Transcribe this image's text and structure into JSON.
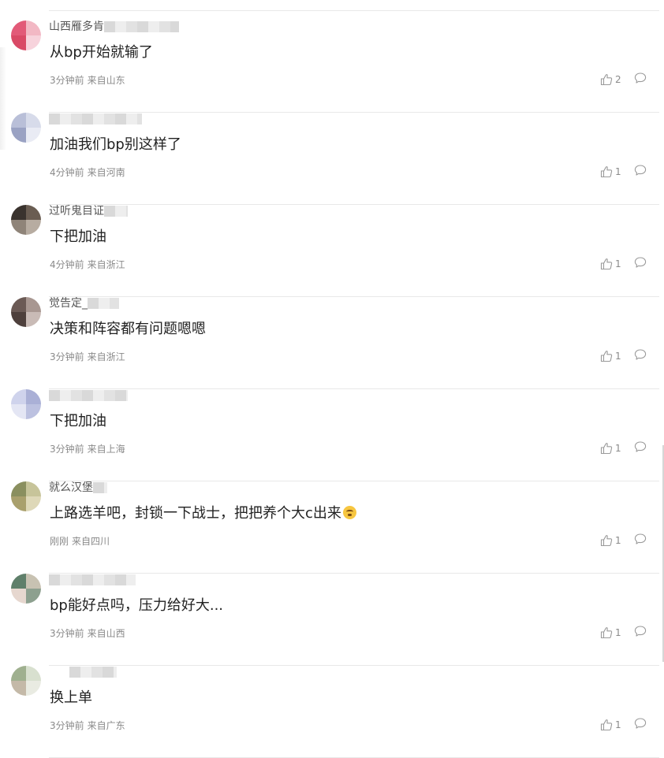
{
  "comments": [
    {
      "username": "山西雁多肯",
      "text": "从bp开始就输了",
      "time": "3分钟前",
      "location": "来自山东",
      "likes": "2",
      "avatar_colors": [
        "#e25a78",
        "#f2b8c4",
        "#d94a66",
        "#f7d3dc"
      ]
    },
    {
      "username": "",
      "text": "加油我们bp别这样了",
      "time": "4分钟前",
      "location": "来自河南",
      "likes": "1",
      "avatar_colors": [
        "#b9bfd8",
        "#d7dbea",
        "#9aa2c3",
        "#e9ebf4"
      ]
    },
    {
      "username": "过听鬼目证",
      "text": "下把加油",
      "time": "4分钟前",
      "location": "来自浙江",
      "likes": "1",
      "avatar_colors": [
        "#3a332e",
        "#6a5d52",
        "#8f8479",
        "#b7aca1"
      ]
    },
    {
      "username": "觉告定_",
      "text": "决策和阵容都有问题嗯嗯",
      "time": "3分钟前",
      "location": "来自浙江",
      "likes": "1",
      "avatar_colors": [
        "#6b5a55",
        "#a89791",
        "#4e403c",
        "#c9bbb6"
      ]
    },
    {
      "username": "",
      "text": "下把加油",
      "time": "3分钟前",
      "location": "来自上海",
      "likes": "1",
      "avatar_colors": [
        "#cfd3ec",
        "#aab0d6",
        "#e4e6f4",
        "#bcc1e0"
      ]
    },
    {
      "username": "就么汉堡",
      "text": "上路选羊吧，封锁一下战士，把把养个大c出来",
      "time": "刚刚",
      "location": "来自四川",
      "likes": "1",
      "avatar_colors": [
        "#8a8f5f",
        "#c7c49a",
        "#a9a06d",
        "#ded8b8"
      ]
    },
    {
      "username": "",
      "text": "bp能好点吗，压力给好大...",
      "time": "3分钟前",
      "location": "来自山西",
      "likes": "1",
      "avatar_colors": [
        "#5f7f6a",
        "#c8c2b2",
        "#e6d7cf",
        "#8da08f"
      ]
    },
    {
      "username": "",
      "text": "换上单",
      "time": "3分钟前",
      "location": "来自广东",
      "likes": "1",
      "avatar_colors": [
        "#9fb08f",
        "#d8e0cf",
        "#c4b9a8",
        "#e9ebe2"
      ]
    }
  ],
  "icons": {
    "like": "thumbs-up-icon",
    "reply": "comment-bubble-icon"
  }
}
